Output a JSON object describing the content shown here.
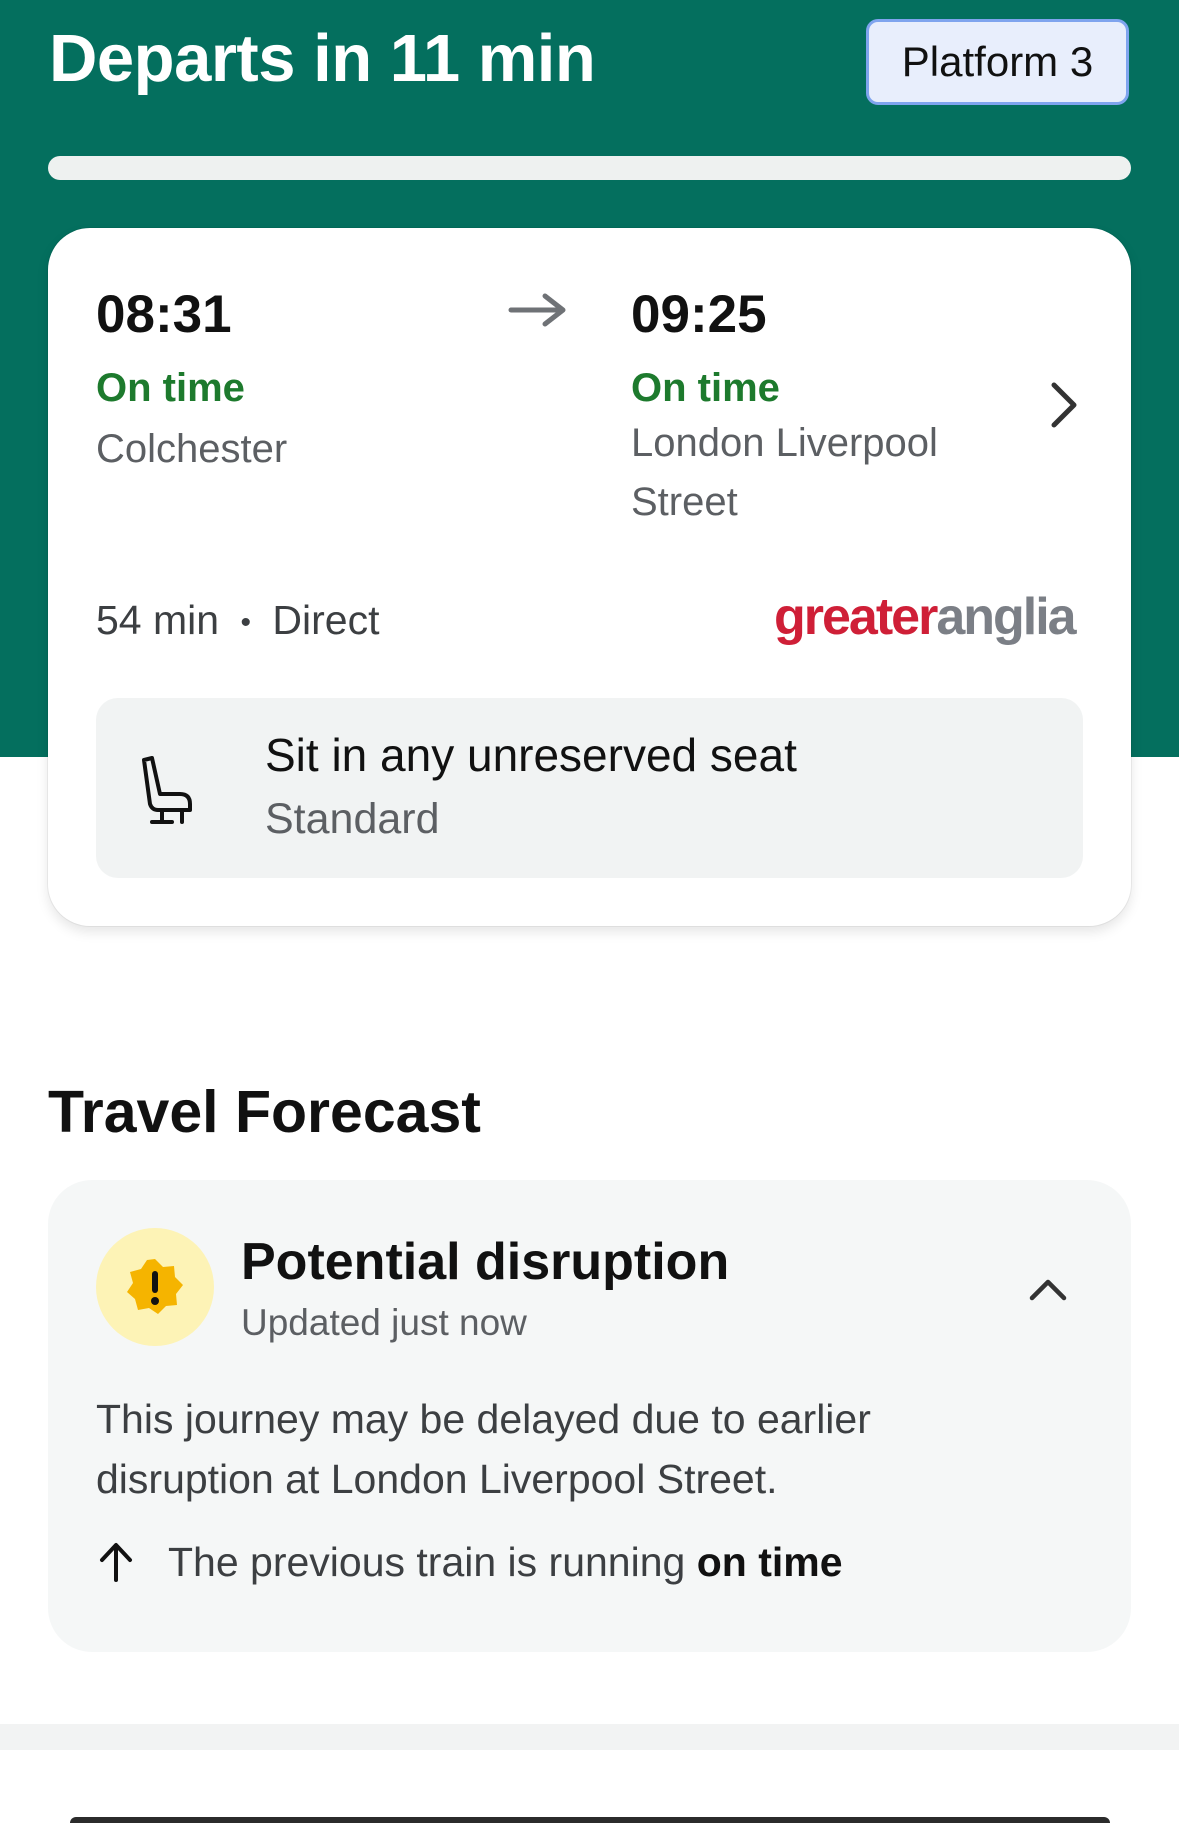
{
  "header": {
    "title": "Departs in 11 min",
    "platform": "Platform 3",
    "colors": {
      "background": "#046f5e",
      "platform_bg": "#e8eefc",
      "platform_border": "#7fa4ee"
    }
  },
  "journey": {
    "depart_time": "08:31",
    "depart_status": "On time",
    "depart_station": "Colchester",
    "arrive_time": "09:25",
    "arrive_status": "On time",
    "arrive_station": "London Liverpool Street",
    "duration": "54 min",
    "separator": "•",
    "type": "Direct",
    "operator_part1": "greater",
    "operator_part2": "anglia",
    "status_color": "#1d7a2d",
    "icons": [
      "arrow-right-icon",
      "chevron-right-icon",
      "seat-icon"
    ]
  },
  "seat": {
    "title": "Sit in any unreserved seat",
    "class": "Standard"
  },
  "forecast": {
    "section_title": "Travel Forecast",
    "title": "Potential disruption",
    "updated": "Updated just now",
    "body": "This journey may be delayed due to earlier disruption at London Liverpool Street.",
    "previous_text": "The previous train is running",
    "previous_status": "on time",
    "icons": [
      "warning-icon",
      "chevron-up-icon",
      "arrow-up-icon"
    ]
  }
}
